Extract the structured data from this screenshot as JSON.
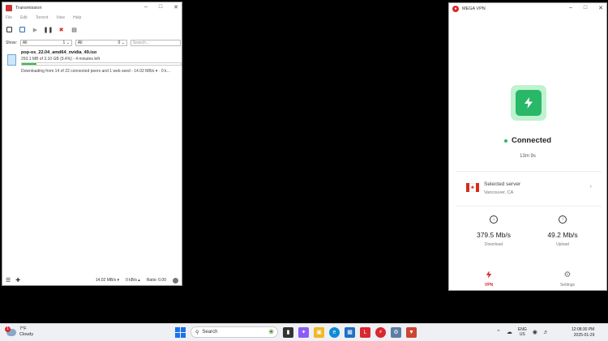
{
  "transmission": {
    "title": "Transmission",
    "menu": [
      "File",
      "Edit",
      "Torrent",
      "View",
      "Help"
    ],
    "filter": {
      "show_label": "Show:",
      "status_value": "All",
      "status_count": "1",
      "tracker_value": "All",
      "tracker_count": "0",
      "search_placeholder": "Search..."
    },
    "torrent": {
      "name": "pop-os_22.04_amd64_nvidia_49.iso",
      "progress_text": "293.1 MB of 3.10 GB (9.4%) - 4 minutes left",
      "progress_fraction": 0.094,
      "status_text": "Downloading from 14 of 22 connected peers and 1 web seed - 14.02 MB/s ▾ · 0 k…"
    },
    "statusbar": {
      "down_speed": "14.02 MB/s ▾",
      "up_speed": "0 kB/s ▴",
      "ratio": "Ratio: 0.00"
    }
  },
  "vpn": {
    "title": "MEGA VPN",
    "status": "Connected",
    "timer": "13m 9s",
    "server_label": "Selected server",
    "server_location": "Vancouver, CA",
    "download_value": "379.5 Mb/s",
    "download_label": "Download",
    "upload_value": "49.2 Mb/s",
    "upload_label": "Upload",
    "nav_vpn": "VPN",
    "nav_settings": "Settings",
    "colors": {
      "accent": "#d9272e",
      "connected": "#28b868"
    }
  },
  "taskbar": {
    "weather_temp": "7°F",
    "weather_cond": "Cloudy",
    "weather_badge": "1",
    "search_label": "Search",
    "lang_top": "ENG",
    "lang_bottom": "US",
    "time": "12:08:30 PM",
    "date": "2025-01-29"
  }
}
